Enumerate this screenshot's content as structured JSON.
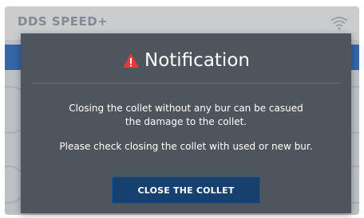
{
  "app": {
    "brand": "DDS SPEED+"
  },
  "status_icons": [
    "wifi-icon"
  ],
  "dialog": {
    "title": "Notification",
    "icon": "warning-icon",
    "message_line1": "Closing the collet without any bur can be casued",
    "message_line2": "the damage to the collet.",
    "message_line3": "Please check closing the collet with used or new bur.",
    "button_label": "CLOSE THE COLLET"
  },
  "colors": {
    "dialog_bg": "#4e555c",
    "button_bg": "#16406e",
    "warning": "#e53935",
    "header_blue": "#3f78c4"
  }
}
